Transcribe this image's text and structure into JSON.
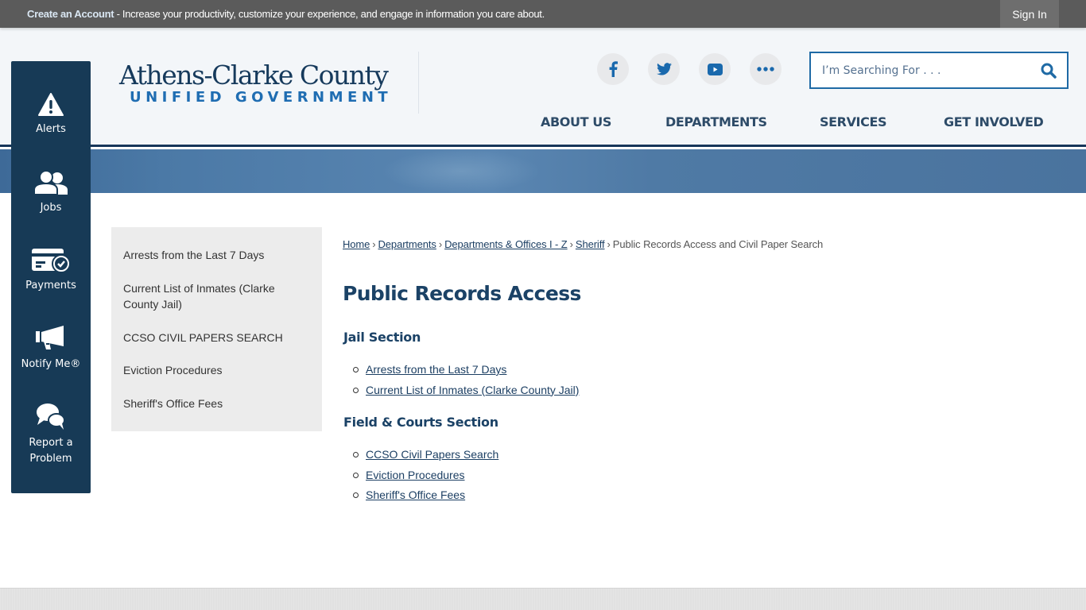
{
  "topbar": {
    "create_account_label": "Create an Account",
    "message": " - Increase your productivity, customize your experience, and engage in information you care about.",
    "sign_in_label": "Sign In"
  },
  "header": {
    "logo_line1": "Athens-Clarke County",
    "logo_line2": "UNIFIED GOVERNMENT",
    "social": [
      {
        "name": "facebook",
        "icon": "facebook-icon"
      },
      {
        "name": "twitter",
        "icon": "twitter-icon"
      },
      {
        "name": "youtube",
        "icon": "youtube-icon"
      },
      {
        "name": "more",
        "icon": "more-dots-icon"
      }
    ],
    "search": {
      "placeholder": "I’m Searching For . . .",
      "value": ""
    },
    "nav": [
      {
        "label": "ABOUT US"
      },
      {
        "label": "DEPARTMENTS"
      },
      {
        "label": "SERVICES"
      },
      {
        "label": "GET INVOLVED"
      }
    ]
  },
  "rail": {
    "items": [
      {
        "label": "Alerts",
        "icon": "warning-icon"
      },
      {
        "label": "Jobs",
        "icon": "users-icon"
      },
      {
        "label": "Payments",
        "icon": "credit-card-check-icon"
      },
      {
        "label": "Notify Me®",
        "icon": "megaphone-icon"
      },
      {
        "label": "Report a Problem",
        "icon": "chat-bubbles-icon"
      }
    ]
  },
  "sidenav": {
    "items": [
      {
        "label": "Arrests from the Last 7 Days"
      },
      {
        "label": "Current List of Inmates (Clarke County Jail)"
      },
      {
        "label": "CCSO CIVIL PAPERS SEARCH"
      },
      {
        "label": "Eviction Procedures"
      },
      {
        "label": "Sheriff's Office Fees"
      }
    ]
  },
  "breadcrumb": {
    "links": [
      {
        "label": "Home"
      },
      {
        "label": "Departments"
      },
      {
        "label": "Departments & Offices I - Z"
      },
      {
        "label": "Sheriff"
      }
    ],
    "current": "Public Records Access and Civil Paper Search",
    "separator": "›"
  },
  "main": {
    "title": "Public Records Access",
    "sections": [
      {
        "heading": "Jail Section",
        "links": [
          {
            "label": "Arrests from the Last 7 Days"
          },
          {
            "label": "Current List of Inmates (Clarke County Jail)"
          }
        ]
      },
      {
        "heading": "Field & Courts Section",
        "links": [
          {
            "label": "CCSO Civil Papers Search"
          },
          {
            "label": "Eviction Procedures"
          },
          {
            "label": "Sheriff's Office Fees"
          }
        ]
      }
    ]
  },
  "colors": {
    "topbar_bg": "#5b5b5b",
    "header_bg": "#f3f6f9",
    "navy": "#173a56",
    "heading": "#1b4266",
    "accent_blue": "#1f6aa5",
    "sidenav_bg": "#ececec"
  }
}
